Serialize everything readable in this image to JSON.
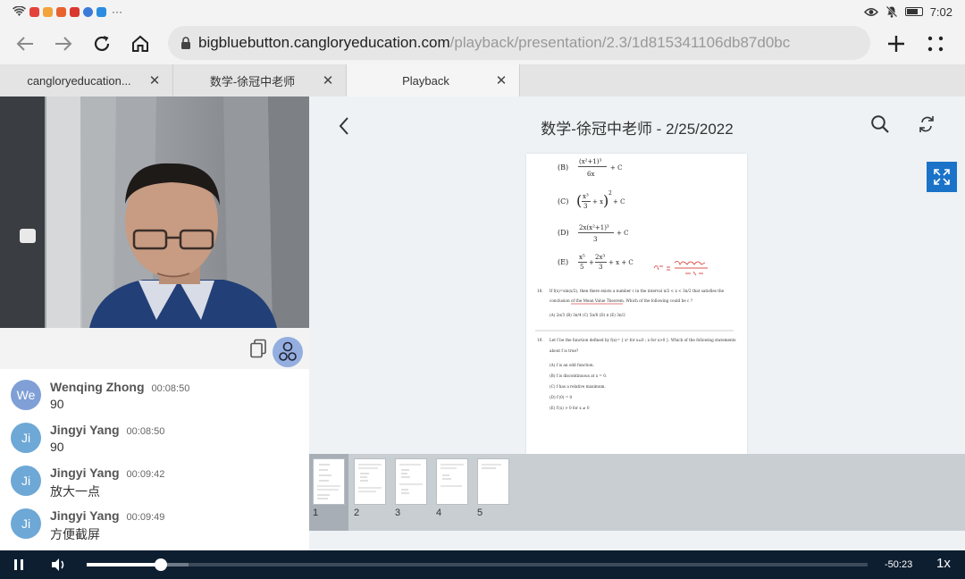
{
  "status_bar": {
    "overflow_text": "···",
    "time": "7:02",
    "icons": [
      "wifi-icon",
      "eye-icon",
      "mute-icon",
      "battery-icon"
    ]
  },
  "browser": {
    "url_host": "bigbluebutton.cangloryeducation.com",
    "url_path": "/playback/presentation/2.3/1d815341106db87d0bc"
  },
  "tabs": [
    {
      "label": "cangloryeducation...",
      "active": false
    },
    {
      "label": "数学-徐冠中老师",
      "active": false
    },
    {
      "label": "Playback",
      "active": true
    }
  ],
  "presentation": {
    "title": "数学-徐冠中老师 - 2/25/2022"
  },
  "chat": {
    "messages": [
      {
        "initials": "We",
        "name": "Wenqing Zhong",
        "time": "00:08:50",
        "text": "90",
        "avatar_color": "#7f9fd6"
      },
      {
        "initials": "Ji",
        "name": "Jingyi Yang",
        "time": "00:08:50",
        "text": "90",
        "avatar_color": "#6da8d6"
      },
      {
        "initials": "Ji",
        "name": "Jingyi Yang",
        "time": "00:09:42",
        "text": "放大一点",
        "avatar_color": "#6da8d6"
      },
      {
        "initials": "Ji",
        "name": "Jingyi Yang",
        "time": "00:09:49",
        "text": "方便截屏",
        "avatar_color": "#6da8d6"
      }
    ]
  },
  "thumbnails": [
    {
      "number": "1",
      "active": true
    },
    {
      "number": "2",
      "active": false
    },
    {
      "number": "3",
      "active": false
    },
    {
      "number": "4",
      "active": false
    },
    {
      "number": "5",
      "active": false
    }
  ],
  "player": {
    "remaining": "-50:23",
    "speed": "1x",
    "progress_fraction": 0.095,
    "buffered_fraction": 0.13
  },
  "colors": {
    "accent": "#1a73c9",
    "player_bg": "#0e1e31"
  }
}
